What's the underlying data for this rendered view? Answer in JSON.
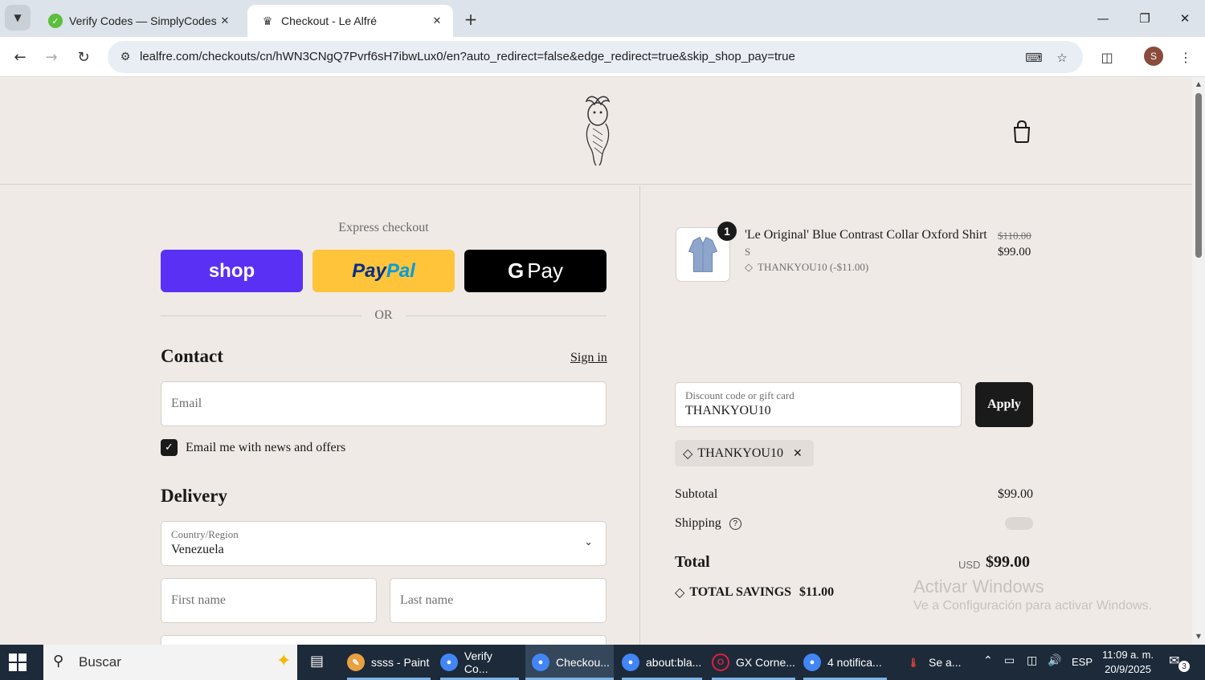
{
  "browser": {
    "tabs": [
      {
        "title": "Verify Codes — SimplyCodes",
        "active": false
      },
      {
        "title": "Checkout - Le Alfré",
        "active": true
      }
    ],
    "url": "lealfre.com/checkouts/cn/hWN3CNgQ7Pvrf6sH7ibwLux0/en?auto_redirect=false&edge_redirect=true&skip_shop_pay=true",
    "profile_initial": "S"
  },
  "checkout": {
    "express_label": "Express checkout",
    "shop_label": "shop",
    "paypal_label_1": "Pay",
    "paypal_label_2": "Pal",
    "gpay_label_g": "G",
    "gpay_label": "Pay",
    "or_label": "OR",
    "contact": {
      "title": "Contact",
      "signin": "Sign in",
      "email_placeholder": "Email",
      "newsletter_label": "Email me with news and offers",
      "newsletter_checked": true
    },
    "delivery": {
      "title": "Delivery",
      "country_label": "Country/Region",
      "country_value": "Venezuela",
      "first_name_placeholder": "First name",
      "last_name_placeholder": "Last name"
    }
  },
  "summary": {
    "item": {
      "quantity": "1",
      "name": "'Le Original' Blue Contrast Collar Oxford Shirt",
      "variant": "S",
      "discount": "THANKYOU10 (-$11.00)",
      "price_old": "$110.00",
      "price": "$99.00"
    },
    "discount_field": {
      "label": "Discount code or gift card",
      "value": "THANKYOU10"
    },
    "apply_label": "Apply",
    "applied_code": "THANKYOU10",
    "subtotal_label": "Subtotal",
    "subtotal_value": "$99.00",
    "shipping_label": "Shipping",
    "total_label": "Total",
    "currency": "USD",
    "total_value": "$99.00",
    "savings_label": "TOTAL SAVINGS",
    "savings_value": "$11.00"
  },
  "watermark": {
    "line1": "Activar Windows",
    "line2": "Ve a Configuración para activar Windows."
  },
  "taskbar": {
    "search_placeholder": "Buscar",
    "tasks": [
      {
        "label": "ssss - Paint"
      },
      {
        "label": "Verify Co..."
      },
      {
        "label": "Checkou..."
      },
      {
        "label": "about:bla..."
      },
      {
        "label": "GX Corne..."
      },
      {
        "label": "4 notifica..."
      },
      {
        "label": "Se a..."
      }
    ],
    "language": "ESP",
    "time": "11:09 a. m.",
    "date": "20/9/2025",
    "notifications": "3"
  }
}
